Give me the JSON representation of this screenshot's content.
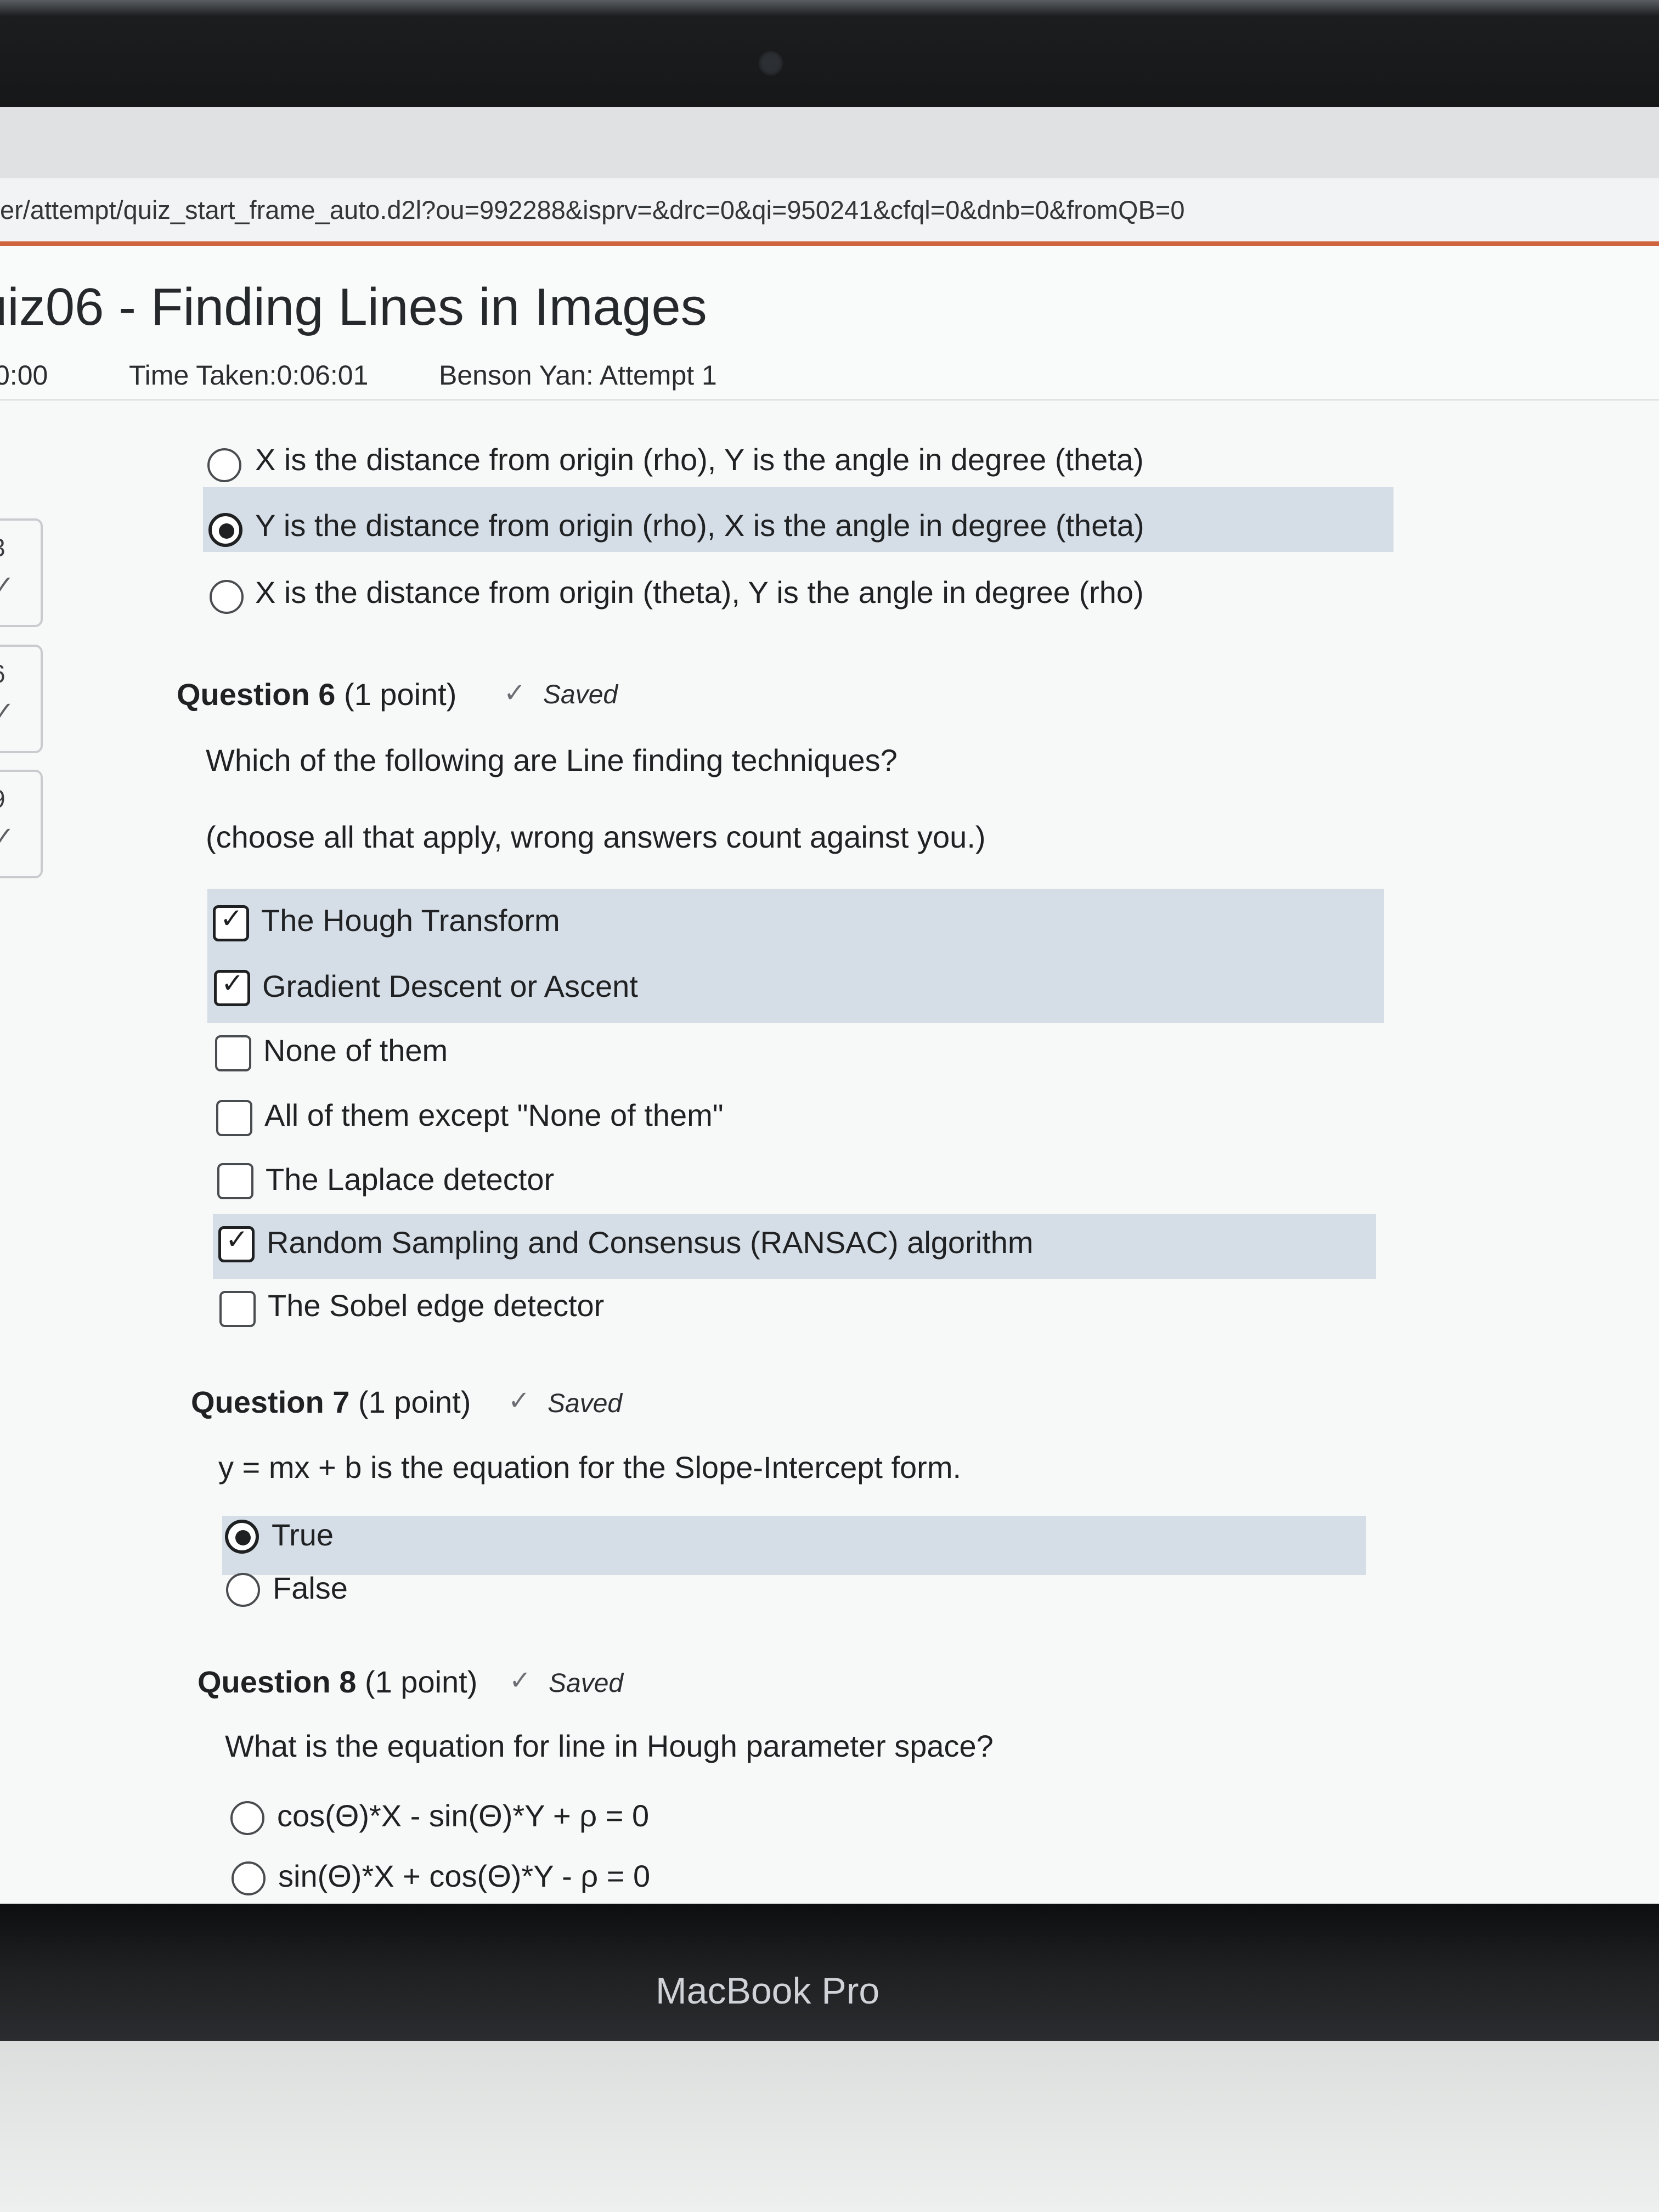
{
  "url": "er/attempt/quiz_start_frame_auto.d2l?ou=992288&isprv=&drc=0&qi=950241&cfql=0&dnb=0&fromQB=0",
  "quiz": {
    "title": "uiz06 - Finding Lines in Images",
    "timer": "0:00",
    "time_taken": "Time Taken:0:06:01",
    "attempt": "Benson Yan: Attempt 1"
  },
  "sidebar": [
    {
      "num": "3",
      "check": "✓"
    },
    {
      "num": "6",
      "check": "✓"
    },
    {
      "num": "9",
      "check": "✓"
    }
  ],
  "q5_options": [
    {
      "label": "X is the distance from origin (rho), Y is the angle in degree (theta)",
      "selected": false
    },
    {
      "label": "Y is the distance from origin (rho), X is the angle in degree (theta)",
      "selected": true
    },
    {
      "label": "X is the distance from origin (theta), Y is the angle in degree (rho)",
      "selected": false
    }
  ],
  "q6": {
    "title": "Question 6",
    "points": "(1 point)",
    "status": "Saved",
    "text": "Which of the following are Line finding techniques?",
    "note": "(choose all that apply, wrong answers count against you.)",
    "options": [
      {
        "label": "The Hough Transform",
        "checked": true
      },
      {
        "label": "Gradient Descent or Ascent",
        "checked": true
      },
      {
        "label": "None of them",
        "checked": false
      },
      {
        "label": "All of them except \"None of them\"",
        "checked": false
      },
      {
        "label": "The Laplace detector",
        "checked": false
      },
      {
        "label": "Random Sampling and Consensus (RANSAC) algorithm",
        "checked": true
      },
      {
        "label": "The Sobel edge detector",
        "checked": false
      }
    ]
  },
  "q7": {
    "title": "Question 7",
    "points": "(1 point)",
    "status": "Saved",
    "text": "y = mx + b is the equation for the Slope-Intercept form.",
    "options": [
      {
        "label": "True",
        "selected": true
      },
      {
        "label": "False",
        "selected": false
      }
    ]
  },
  "q8": {
    "title": "Question 8",
    "points": "(1 point)",
    "status": "Saved",
    "text": "What is the equation for line in Hough parameter space?",
    "options": [
      {
        "label": "cos(Θ)*X - sin(Θ)*Y + ρ = 0",
        "selected": false
      },
      {
        "label": "sin(Θ)*X + cos(Θ)*Y - ρ = 0",
        "selected": false
      }
    ]
  },
  "device_label": "MacBook Pro",
  "colors": {
    "accent": "#d0643f",
    "selected_row": "#d5dde6"
  }
}
